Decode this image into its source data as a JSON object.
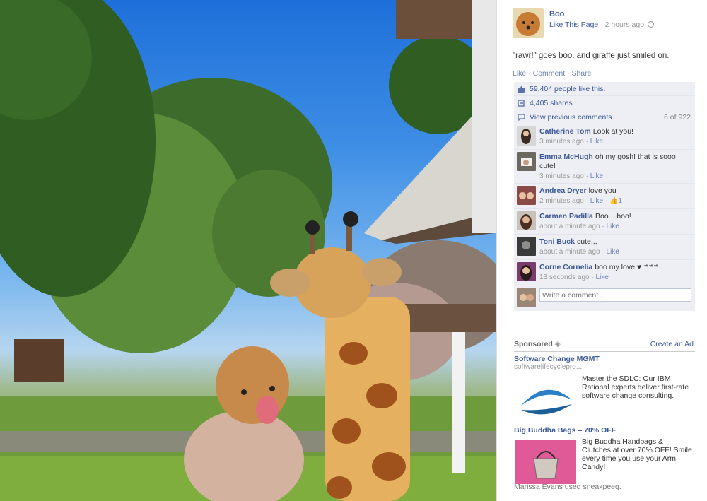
{
  "post": {
    "page_name": "Boo",
    "like_page": "Like This Page",
    "time": "2 hours ago",
    "text": "\"rawr!\" goes boo. and giraffe just smiled on.",
    "actions": {
      "like": "Like",
      "comment": "Comment",
      "share": "Share"
    }
  },
  "ufi": {
    "likes": "59,404 people like this.",
    "shares": "4,405 shares",
    "view_previous": "View previous comments",
    "comment_count": "6 of 922",
    "comments": [
      {
        "name": "Catherine Tom",
        "text": "Löok at you!",
        "time": "3 minutes ago",
        "like": "Like",
        "likes": ""
      },
      {
        "name": "Emma McHugh",
        "text": "oh my gosh! that is sooo cute!",
        "time": "3 minutes ago",
        "like": "Like",
        "likes": ""
      },
      {
        "name": "Andrea Dryer",
        "text": "love you",
        "time": "2 minutes ago",
        "like": "Like",
        "likes": "1"
      },
      {
        "name": "Carmen Padilla",
        "text": "Boo....boo!",
        "time": "about a minute ago",
        "like": "Like",
        "likes": ""
      },
      {
        "name": "Toni Buck",
        "text": "cute,,,",
        "time": "about a minute ago",
        "like": "Like",
        "likes": ""
      },
      {
        "name": "Corne Cornelia",
        "text": "boo my love ♥ :*:*:*",
        "time": "13 seconds ago",
        "like": "Like",
        "likes": ""
      }
    ],
    "write_placeholder": "Write a comment..."
  },
  "sponsored": {
    "label": "Sponsored",
    "create_ad": "Create an Ad",
    "ads": [
      {
        "title": "Software Change MGMT",
        "url": "softwarelifecyclepro...",
        "body": "Master the SDLC: Our IBM Rational experts deliver first-rate software change consulting."
      },
      {
        "title": "Big Buddha Bags – 70% OFF",
        "url": "",
        "body": "Big Buddha Handbags & Clutches at over 70% OFF! Smile every time you use your Arm Candy!"
      }
    ],
    "social_line": "Marissa Evans used sneakpeeq."
  },
  "icons": [
    "globe-icon",
    "thumbs-up-icon",
    "share-icon",
    "comment-bubble-icon",
    "sponsored-icon"
  ],
  "colors": {
    "link": "#3b5998",
    "ufi_bg": "#edeff4",
    "sky": "#1e6fd9"
  }
}
